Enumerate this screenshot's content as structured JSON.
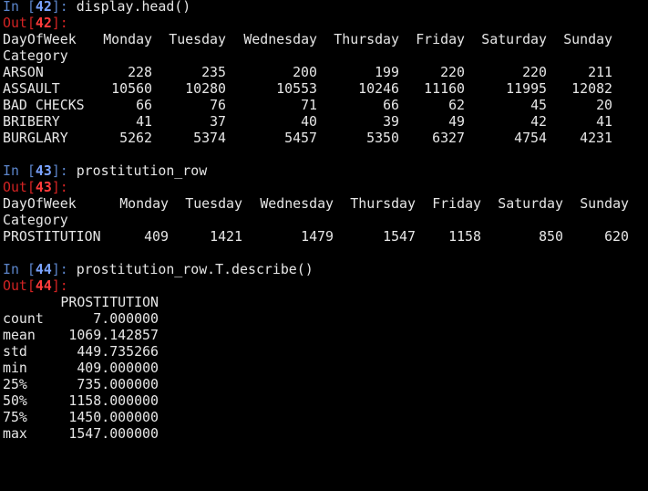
{
  "cells": [
    {
      "in_label": "In [",
      "in_num": "42",
      "in_close": "]:",
      "code": "display.head()",
      "out_label": "Out[",
      "out_num": "42",
      "out_close": "]:",
      "index_name": "DayOfWeek",
      "row_label": "Category",
      "columns": [
        "Monday",
        "Tuesday",
        "Wednesday",
        "Thursday",
        "Friday",
        "Saturday",
        "Sunday"
      ],
      "rows": [
        {
          "label": "ARSON",
          "values": [
            "228",
            "235",
            "200",
            "199",
            "220",
            "220",
            "211"
          ]
        },
        {
          "label": "ASSAULT",
          "values": [
            "10560",
            "10280",
            "10553",
            "10246",
            "11160",
            "11995",
            "12082"
          ]
        },
        {
          "label": "BAD CHECKS",
          "values": [
            "66",
            "76",
            "71",
            "66",
            "62",
            "45",
            "20"
          ]
        },
        {
          "label": "BRIBERY",
          "values": [
            "41",
            "37",
            "40",
            "39",
            "49",
            "42",
            "41"
          ]
        },
        {
          "label": "BURGLARY",
          "values": [
            "5262",
            "5374",
            "5457",
            "5350",
            "6327",
            "4754",
            "4231"
          ]
        }
      ]
    },
    {
      "in_label": "In [",
      "in_num": "43",
      "in_close": "]:",
      "code": "prostitution_row",
      "out_label": "Out[",
      "out_num": "43",
      "out_close": "]:",
      "index_name": "DayOfWeek",
      "row_label": "Category",
      "columns": [
        "Monday",
        "Tuesday",
        "Wednesday",
        "Thursday",
        "Friday",
        "Saturday",
        "Sunday"
      ],
      "rows": [
        {
          "label": "PROSTITUTION",
          "values": [
            "409",
            "1421",
            "1479",
            "1547",
            "1158",
            "850",
            "620"
          ]
        }
      ]
    },
    {
      "in_label": "In [",
      "in_num": "44",
      "in_close": "]:",
      "code": "prostitution_row.T.describe()",
      "out_label": "Out[",
      "out_num": "44",
      "out_close": "]:",
      "column": "PROSTITUTION",
      "rows": [
        {
          "label": "count",
          "value": "7.000000"
        },
        {
          "label": "mean",
          "value": "1069.142857"
        },
        {
          "label": "std",
          "value": "449.735266"
        },
        {
          "label": "min",
          "value": "409.000000"
        },
        {
          "label": "25%",
          "value": "735.000000"
        },
        {
          "label": "50%",
          "value": "1158.000000"
        },
        {
          "label": "75%",
          "value": "1450.000000"
        },
        {
          "label": "max",
          "value": "1547.000000"
        }
      ]
    }
  ],
  "colors": {
    "background": "#000000",
    "text": "#e6e6e6",
    "in_prompt": "#5b84c9",
    "out_prompt": "#d22323"
  }
}
